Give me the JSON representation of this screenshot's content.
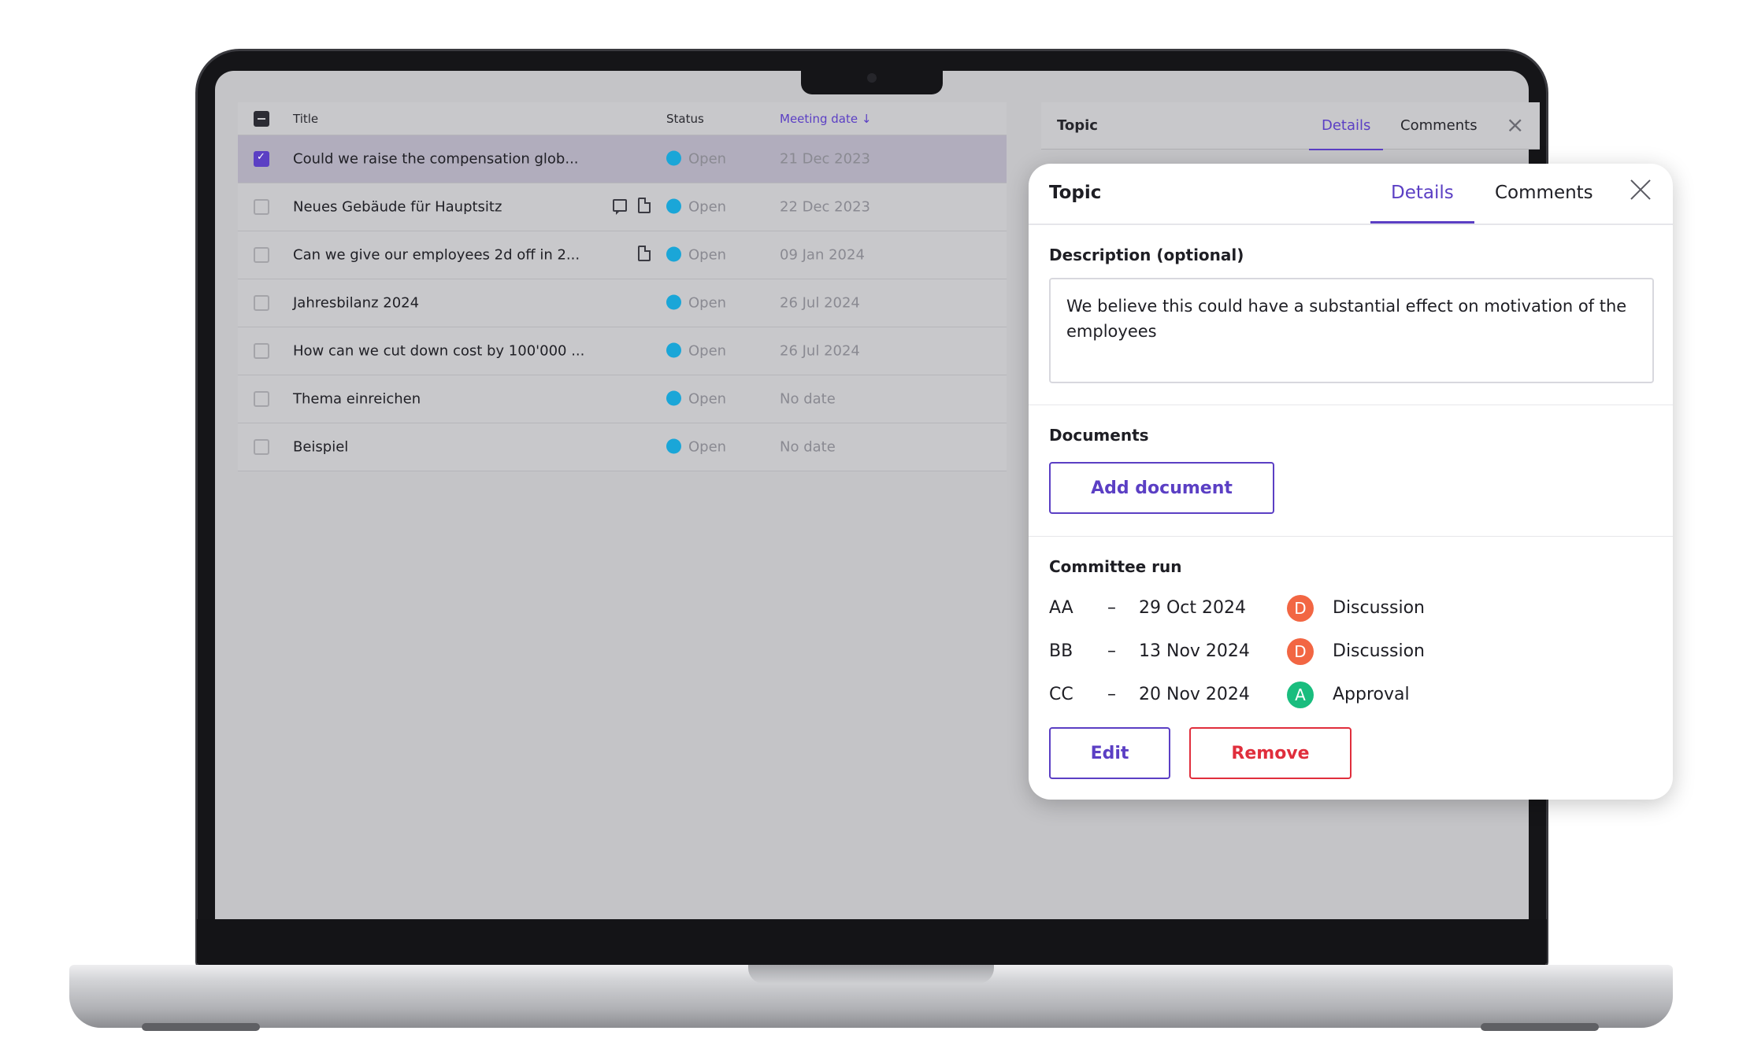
{
  "table": {
    "columns": {
      "title": "Title",
      "status": "Status",
      "meeting_date": "Meeting date ↓"
    },
    "rows": [
      {
        "title": "Could we raise the compensation glob...",
        "status": "Open",
        "date": "21 Dec 2023",
        "selected": true
      },
      {
        "title": "Neues Gebäude für Hauptsitz",
        "status": "Open",
        "date": "22 Dec 2023"
      },
      {
        "title": "Can we give our employees 2d off in 2...",
        "status": "Open",
        "date": "09 Jan 2024"
      },
      {
        "title": "Jahresbilanz 2024",
        "status": "Open",
        "date": "26 Jul 2024"
      },
      {
        "title": "How can we cut down cost by 100'000 ...",
        "status": "Open",
        "date": "26 Jul 2024"
      },
      {
        "title": "Thema einreichen",
        "status": "Open",
        "date": "No date"
      },
      {
        "title": "Beispiel",
        "status": "Open",
        "date": "No date"
      }
    ],
    "row_icons": [
      "comment-icon",
      "document-icon"
    ],
    "status_color": "#1aa6d8"
  },
  "panel": {
    "title": "Topic",
    "tabs": {
      "details": "Details",
      "comments": "Comments"
    }
  },
  "card": {
    "title": "Topic",
    "tabs": {
      "details": "Details",
      "comments": "Comments"
    },
    "description_label": "Description (optional)",
    "description_value": "We believe this could have a substantial effect on motivation of the employees",
    "documents_label": "Documents",
    "add_document": "Add document",
    "committee_label": "Committee run",
    "committee": [
      {
        "code": "AA",
        "dash": "–",
        "date": "29 Oct 2024",
        "badge": "D",
        "type": "Discussion",
        "color": "#f26643"
      },
      {
        "code": "BB",
        "dash": "–",
        "date": "13 Nov 2024",
        "badge": "D",
        "type": "Discussion",
        "color": "#f26643"
      },
      {
        "code": "CC",
        "dash": "–",
        "date": "20 Nov 2024",
        "badge": "A",
        "type": "Approval",
        "color": "#19bd7e"
      }
    ],
    "edit": "Edit",
    "remove": "Remove"
  },
  "colors": {
    "accent": "#5b3fc4",
    "danger": "#e02e3c"
  }
}
